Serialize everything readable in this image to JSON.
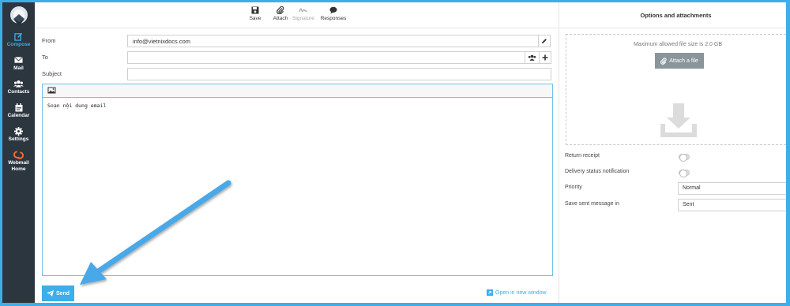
{
  "sidebar": {
    "items": [
      {
        "label": "Compose",
        "icon": "compose-icon",
        "active": true
      },
      {
        "label": "Mail",
        "icon": "mail-icon"
      },
      {
        "label": "Contacts",
        "icon": "contacts-icon"
      },
      {
        "label": "Calendar",
        "icon": "calendar-icon"
      },
      {
        "label": "Settings",
        "icon": "gear-icon"
      },
      {
        "label_line1": "Webmail",
        "label_line2": "Home",
        "icon": "cpanel-icon"
      }
    ]
  },
  "toolbar": {
    "save_label": "Save",
    "attach_label": "Attach",
    "signature_label": "Signature",
    "responses_label": "Responses"
  },
  "compose": {
    "from_label": "From",
    "from_value": "info@vietnixdocs.com",
    "to_label": "To",
    "to_value": "",
    "subject_label": "Subject",
    "subject_value": "",
    "body_text": "Soạn nội dung email",
    "send_label": "Send",
    "open_new_window_label": "Open in new window"
  },
  "options": {
    "header": "Options and attachments",
    "max_size_text": "Maximum allowed file size is 2.0 GB",
    "attach_file_label": "Attach a file",
    "return_receipt_label": "Return receipt",
    "dsn_label": "Delivery status notification",
    "priority_label": "Priority",
    "priority_value": "Normal",
    "save_sent_label": "Save sent message in",
    "save_sent_value": "Sent"
  },
  "colors": {
    "accent": "#3daee9",
    "sidebar_bg": "#2c363f",
    "annotation_arrow": "#4aa8e8"
  }
}
